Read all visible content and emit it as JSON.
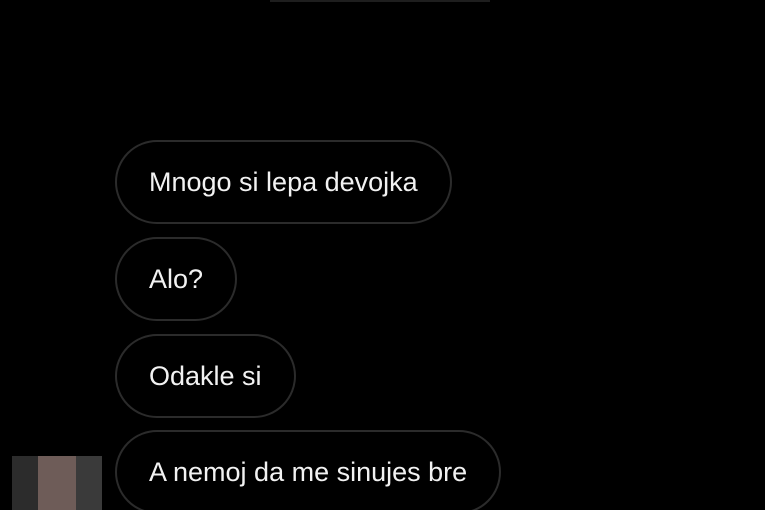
{
  "messages": [
    {
      "text": "Mnogo si lepa devojka"
    },
    {
      "text": "Alo?"
    },
    {
      "text": "Odakle si"
    },
    {
      "text": "A nemoj da me sinujes bre"
    }
  ],
  "colors": {
    "background": "#000000",
    "bubble_border": "#2b2b2b",
    "text": "#f2f2f2"
  }
}
